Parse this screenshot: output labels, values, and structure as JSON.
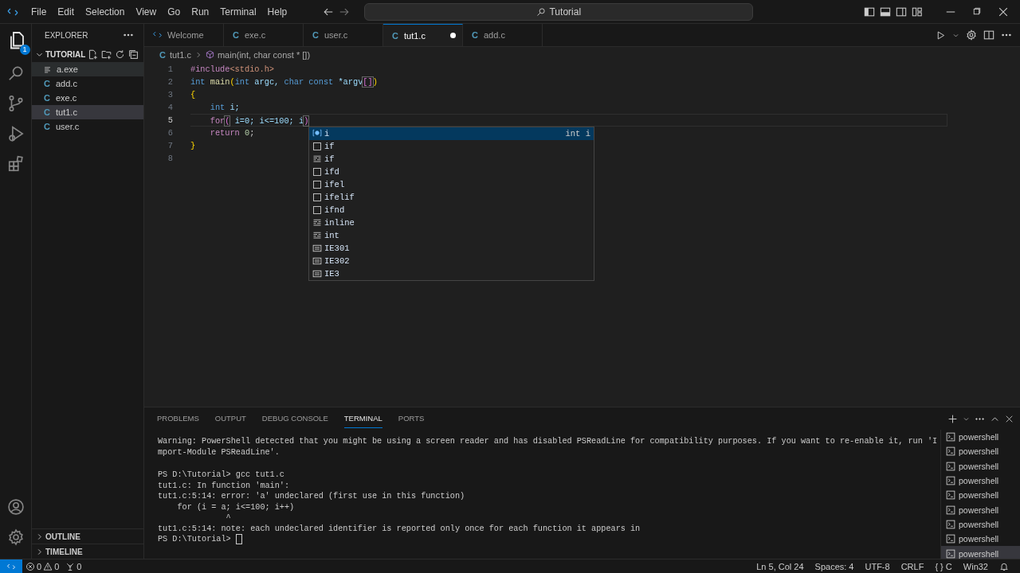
{
  "title_bar": {
    "menus": [
      "File",
      "Edit",
      "Selection",
      "View",
      "Go",
      "Run",
      "Terminal",
      "Help"
    ],
    "search": "Tutorial"
  },
  "activity_bar": {
    "explorer_badge": "1"
  },
  "explorer": {
    "title": "EXPLORER",
    "folder": "TUTORIAL",
    "expanded": true,
    "files": [
      {
        "name": "a.exe",
        "kind": "binary",
        "selected": false,
        "hovered": true
      },
      {
        "name": "add.c",
        "kind": "c",
        "icon": "C",
        "selected": false,
        "hovered": false
      },
      {
        "name": "exe.c",
        "kind": "c",
        "icon": "C",
        "selected": false,
        "hovered": false
      },
      {
        "name": "tut1.c",
        "kind": "c",
        "icon": "C",
        "selected": true,
        "hovered": false
      },
      {
        "name": "user.c",
        "kind": "c",
        "icon": "C",
        "selected": false,
        "hovered": false
      }
    ],
    "sections": [
      {
        "name": "OUTLINE",
        "expanded": false
      },
      {
        "name": "TIMELINE",
        "expanded": false
      }
    ]
  },
  "tabs": [
    {
      "label": "Welcome",
      "kind": "welcome",
      "selected": false,
      "modified": false
    },
    {
      "label": "exe.c",
      "kind": "c",
      "icon": "C",
      "selected": false,
      "modified": false
    },
    {
      "label": "user.c",
      "kind": "c",
      "icon": "C",
      "selected": false,
      "modified": false
    },
    {
      "label": "tut1.c",
      "kind": "c",
      "icon": "C",
      "selected": true,
      "modified": true
    },
    {
      "label": "add.c",
      "kind": "c",
      "icon": "C",
      "selected": false,
      "modified": false
    }
  ],
  "breadcrumb": {
    "icon": "C",
    "file": "tut1.c",
    "symbol": "main(int, char const * [])"
  },
  "code": [
    {
      "number": "1",
      "current": false,
      "tokens": [
        {
          "text": "#include",
          "kind": "preproc"
        },
        {
          "text": "<stdio.h>",
          "kind": "string"
        }
      ]
    },
    {
      "number": "2",
      "current": false,
      "tokens": [
        {
          "text": "int",
          "kind": "keyword"
        },
        {
          "text": " main",
          "kind": "function"
        },
        {
          "text": "(",
          "kind": "bracket"
        },
        {
          "text": "int",
          "kind": "keyword"
        },
        {
          "text": " argc, ",
          "kind": "variable"
        },
        {
          "text": "char const",
          "kind": "keyword"
        },
        {
          "text": " *argv",
          "kind": "variable"
        },
        {
          "text": "[]",
          "kind": "bracket2"
        },
        {
          "text": ")",
          "kind": "bracket"
        }
      ]
    },
    {
      "number": "3",
      "current": false,
      "tokens": [
        {
          "text": "{",
          "kind": "bracket"
        }
      ]
    },
    {
      "number": "4",
      "current": false,
      "tokens": [
        {
          "text": "    int",
          "kind": "keyword"
        },
        {
          "text": " i;",
          "kind": "variable"
        }
      ]
    },
    {
      "number": "5",
      "current": true,
      "tokens": [
        {
          "text": "    for",
          "kind": "control"
        },
        {
          "text": "(",
          "kind": "bracket2"
        },
        {
          "text": " i=0; i<=100; i",
          "kind": "variable"
        },
        {
          "text": ")",
          "kind": "bracket2"
        }
      ]
    },
    {
      "number": "6",
      "current": false,
      "tokens": [
        {
          "text": "    return",
          "kind": "control"
        },
        {
          "text": " 0",
          "kind": "number"
        },
        {
          "text": ";",
          "kind": "plain"
        }
      ]
    },
    {
      "number": "7",
      "current": false,
      "tokens": [
        {
          "text": "}",
          "kind": "bracket"
        }
      ]
    },
    {
      "number": "8",
      "current": false
    }
  ],
  "suggestions": [
    {
      "label": "i",
      "kind": "variable",
      "selected": true,
      "detail": "int i"
    },
    {
      "label": "if",
      "kind": "keyword",
      "selected": false
    },
    {
      "label": "if",
      "kind": "snippet",
      "selected": false
    },
    {
      "label": "ifd",
      "kind": "keyword",
      "selected": false
    },
    {
      "label": "ifel",
      "kind": "keyword",
      "selected": false
    },
    {
      "label": "ifelif",
      "kind": "keyword",
      "selected": false
    },
    {
      "label": "ifnd",
      "kind": "keyword",
      "selected": false
    },
    {
      "label": "inline",
      "kind": "snippet",
      "selected": false
    },
    {
      "label": "int",
      "kind": "snippet",
      "selected": false
    },
    {
      "label": "IE301",
      "kind": "constant",
      "selected": false
    },
    {
      "label": "IE302",
      "kind": "constant",
      "selected": false
    },
    {
      "label": "IE3",
      "kind": "constant",
      "selected": false
    }
  ],
  "panel": {
    "tabs": [
      {
        "label": "PROBLEMS",
        "selected": false
      },
      {
        "label": "OUTPUT",
        "selected": false
      },
      {
        "label": "DEBUG CONSOLE",
        "selected": false
      },
      {
        "label": "TERMINAL",
        "selected": true
      },
      {
        "label": "PORTS",
        "selected": false
      }
    ],
    "terminal": [
      [
        "Warning: PowerShell detected that you might be using a screen reader and has disabled PSReadLine for compatibility purposes. If you want to re-enable it, run 'I",
        "mport-Module PSReadLine'."
      ],
      [
        "PS D:\\Tutorial> gcc tut1.c",
        "tut1.c: In function 'main':",
        "tut1.c:5:14: error: 'a' undeclared (first use in this function)",
        "    for (i = a; i<=100; i++)",
        "              ^",
        "tut1.c:5:14: note: each undeclared identifier is reported only once for each function it appears in",
        "PS D:\\Tutorial> "
      ]
    ],
    "instances": [
      {
        "label": "powershell",
        "selected": false
      },
      {
        "label": "powershell",
        "selected": false
      },
      {
        "label": "powershell",
        "selected": false
      },
      {
        "label": "powershell",
        "selected": false
      },
      {
        "label": "powershell",
        "selected": false
      },
      {
        "label": "powershell",
        "selected": false
      },
      {
        "label": "powershell",
        "selected": false
      },
      {
        "label": "powershell",
        "selected": false
      },
      {
        "label": "powershell",
        "selected": true
      }
    ]
  },
  "status_bar": {
    "errors": "0",
    "warnings": "0",
    "ports": "0",
    "items": [
      "Ln 5, Col 24",
      "Spaces: 4",
      "UTF-8",
      "CRLF"
    ],
    "language_icon": "{ }",
    "language": "C",
    "platform": "Win32"
  }
}
